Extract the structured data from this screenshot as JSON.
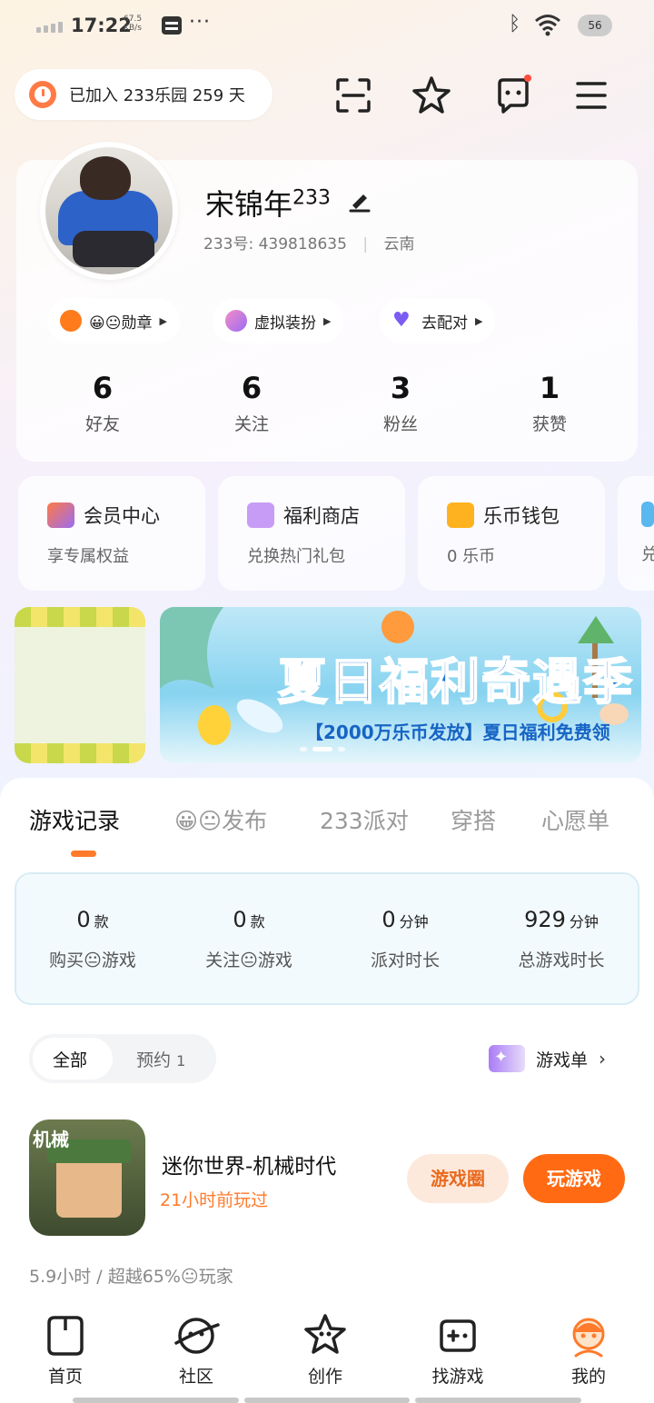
{
  "status_bar": {
    "time": "17:22",
    "speed_value": "67.5",
    "speed_unit": "KB/s",
    "battery": "56",
    "more_icon": "ellipsis-icon",
    "bluetooth_icon": "bluetooth-icon",
    "wifi_icon": "wifi-icon"
  },
  "header": {
    "joined_prefix": "已加入 233乐园",
    "joined_days": "259",
    "joined_suffix": "天",
    "icons": [
      "scan-icon",
      "star-collection-icon",
      "message-icon",
      "menu-icon"
    ]
  },
  "profile": {
    "name": "宋锦年",
    "name_sup": "233",
    "id_label": "233号:",
    "id_value": "439818635",
    "location": "云南",
    "pills": [
      {
        "label": "😀😐勋章"
      },
      {
        "label": "虚拟装扮"
      },
      {
        "label": "去配对"
      }
    ],
    "stats": [
      {
        "value": "6",
        "label": "好友"
      },
      {
        "value": "6",
        "label": "关注"
      },
      {
        "value": "3",
        "label": "粉丝"
      },
      {
        "value": "1",
        "label": "获赞"
      }
    ]
  },
  "quick_cards": [
    {
      "title": "会员中心",
      "subtitle": "享专属权益",
      "icon": "vip-crown-icon",
      "color": "#ff7a45"
    },
    {
      "title": "福利商店",
      "subtitle": "兑换热门礼包",
      "icon": "gift-icon",
      "color": "#b88af5"
    },
    {
      "title": "乐币钱包",
      "subtitle": "0 乐币",
      "icon": "wallet-icon",
      "color": "#ffb21f"
    },
    {
      "title": "",
      "subtitle": "兑",
      "icon": "drop-icon",
      "color": "#5ab8f0"
    }
  ],
  "banner": {
    "title": "夏日福利奇遇季",
    "subtitle": "【2000万乐币发放】夏日福利免费领"
  },
  "tabs": [
    {
      "label": "游戏记录",
      "active": true
    },
    {
      "label": "😀😐发布",
      "active": false
    },
    {
      "label": "233派对",
      "active": false
    },
    {
      "label": "穿搭",
      "active": false
    },
    {
      "label": "心愿单",
      "active": false
    }
  ],
  "summary": [
    {
      "value": "0",
      "unit": "款",
      "label": "购买😐游戏"
    },
    {
      "value": "0",
      "unit": "款",
      "label": "关注😐游戏"
    },
    {
      "value": "0",
      "unit": "分钟",
      "label": "派对时长"
    },
    {
      "value": "929",
      "unit": "分钟",
      "label": "总游戏时长"
    }
  ],
  "filter": {
    "all_label": "全部",
    "reserve_label": "预约",
    "reserve_count": "1",
    "game_list_label": "游戏单"
  },
  "game": {
    "icon_tag": "机械",
    "name": "迷你世界-机械时代",
    "last_played": "21小时前玩过",
    "circle_btn": "游戏圈",
    "play_btn": "玩游戏",
    "stat": "5.9小时 / 超越65%😐玩家"
  },
  "bottom_nav": [
    {
      "label": "首页",
      "icon": "home-icon"
    },
    {
      "label": "社区",
      "icon": "planet-icon"
    },
    {
      "label": "创作",
      "icon": "star-create-icon"
    },
    {
      "label": "找游戏",
      "icon": "gamepad-icon"
    },
    {
      "label": "我的",
      "icon": "profile-face-icon",
      "active": true
    }
  ]
}
